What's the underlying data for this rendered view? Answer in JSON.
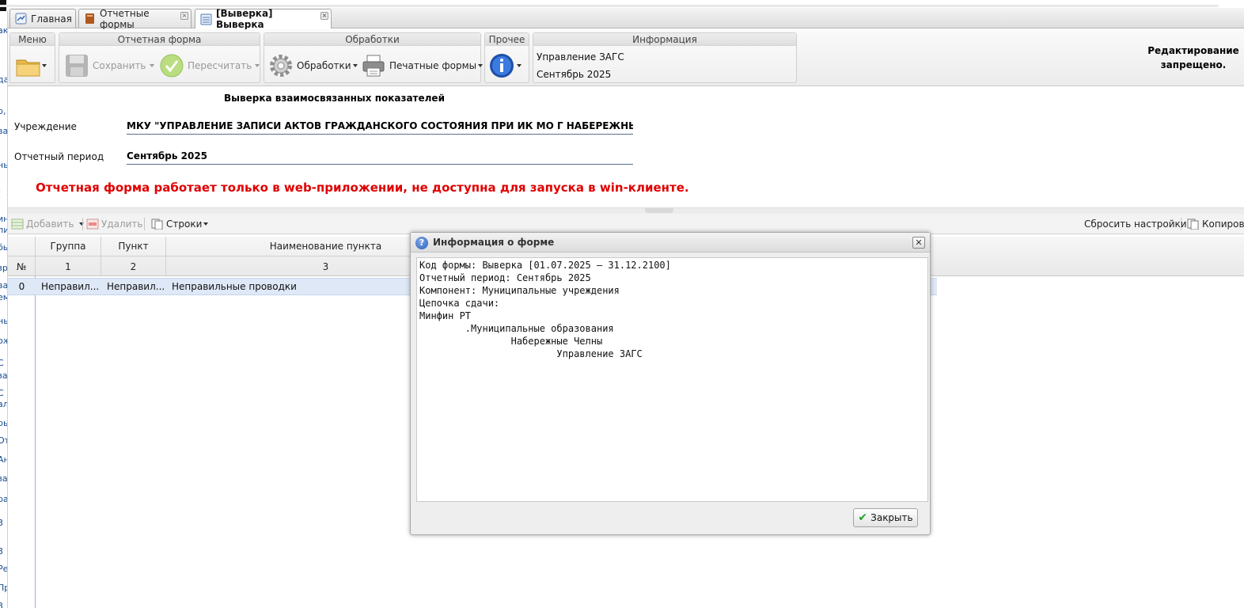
{
  "left_sidebar_fragments": [
    "ак",
    "да",
    "р,",
    "ва",
    "ны",
    "(",
    "ин",
    "пи",
    "бы",
    "зр",
    "ва",
    "ем",
    "ны",
    "ож",
    "С",
    "за",
    "С",
    "ал",
    "ры",
    "От",
    "Ан",
    "за",
    "ра",
    "3",
    "3",
    "Ре",
    "Пр",
    "3"
  ],
  "tabs": [
    {
      "label": "Главная",
      "icon": "home-icon"
    },
    {
      "label": "Отчетные формы",
      "icon": "book-icon"
    },
    {
      "label": "[Выверка] Выверка",
      "icon": "form-icon",
      "active": true
    }
  ],
  "toolbar": {
    "menu": {
      "title": "Меню"
    },
    "report_form": {
      "title": "Отчетная форма",
      "save": "Сохранить",
      "recalc": "Пересчитать"
    },
    "processing": {
      "title": "Обработки",
      "processing_btn": "Обработки",
      "print_btn": "Печатные формы"
    },
    "other": {
      "title": "Прочее"
    },
    "info": {
      "title": "Информация",
      "line1": "Управление ЗАГС",
      "line2": "Сентябрь 2025"
    },
    "readonly": "Редактирование запрещено."
  },
  "form": {
    "title": "Выверка взаимосвязанных показателей",
    "institution_label": "Учреждение",
    "institution_value": "МКУ \"УПРАВЛЕНИЕ ЗАПИСИ АКТОВ ГРАЖДАНСКОГО СОСТОЯНИЯ ПРИ ИК МО Г НАБЕРЕЖНЫЕ ЧЕЛНЫ\"",
    "period_label": "Отчетный период",
    "period_value": "Сентябрь 2025",
    "warning": "Отчетная форма работает только в web-приложении, не доступна для запуска в win-клиенте."
  },
  "grid_toolbar": {
    "add": "Добавить",
    "delete": "Удалить",
    "rows": "Строки",
    "reset": "Сбросить настройки",
    "copy": "Копирова"
  },
  "grid": {
    "headers": {
      "group": "Группа",
      "item": "Пункт",
      "name": "Наименование пункта",
      "num": "№",
      "c1": "1",
      "c2": "2",
      "c3": "3"
    },
    "rows": [
      {
        "num": "0",
        "group": "Неправил...",
        "item": "Неправил...",
        "name": "Неправильные проводки"
      }
    ]
  },
  "dialog": {
    "title": "Информация о форме",
    "content": "Код формы: Выверка [01.07.2025 – 31.12.2100]\nОтчетный период: Сентябрь 2025\nКомпонент: Муниципальные учреждения\nЦепочка сдачи:\nМинфин РТ\n        .Муниципальные образования\n                Набережные Челны\n                        Управление ЗАГС",
    "close": "Закрыть"
  }
}
